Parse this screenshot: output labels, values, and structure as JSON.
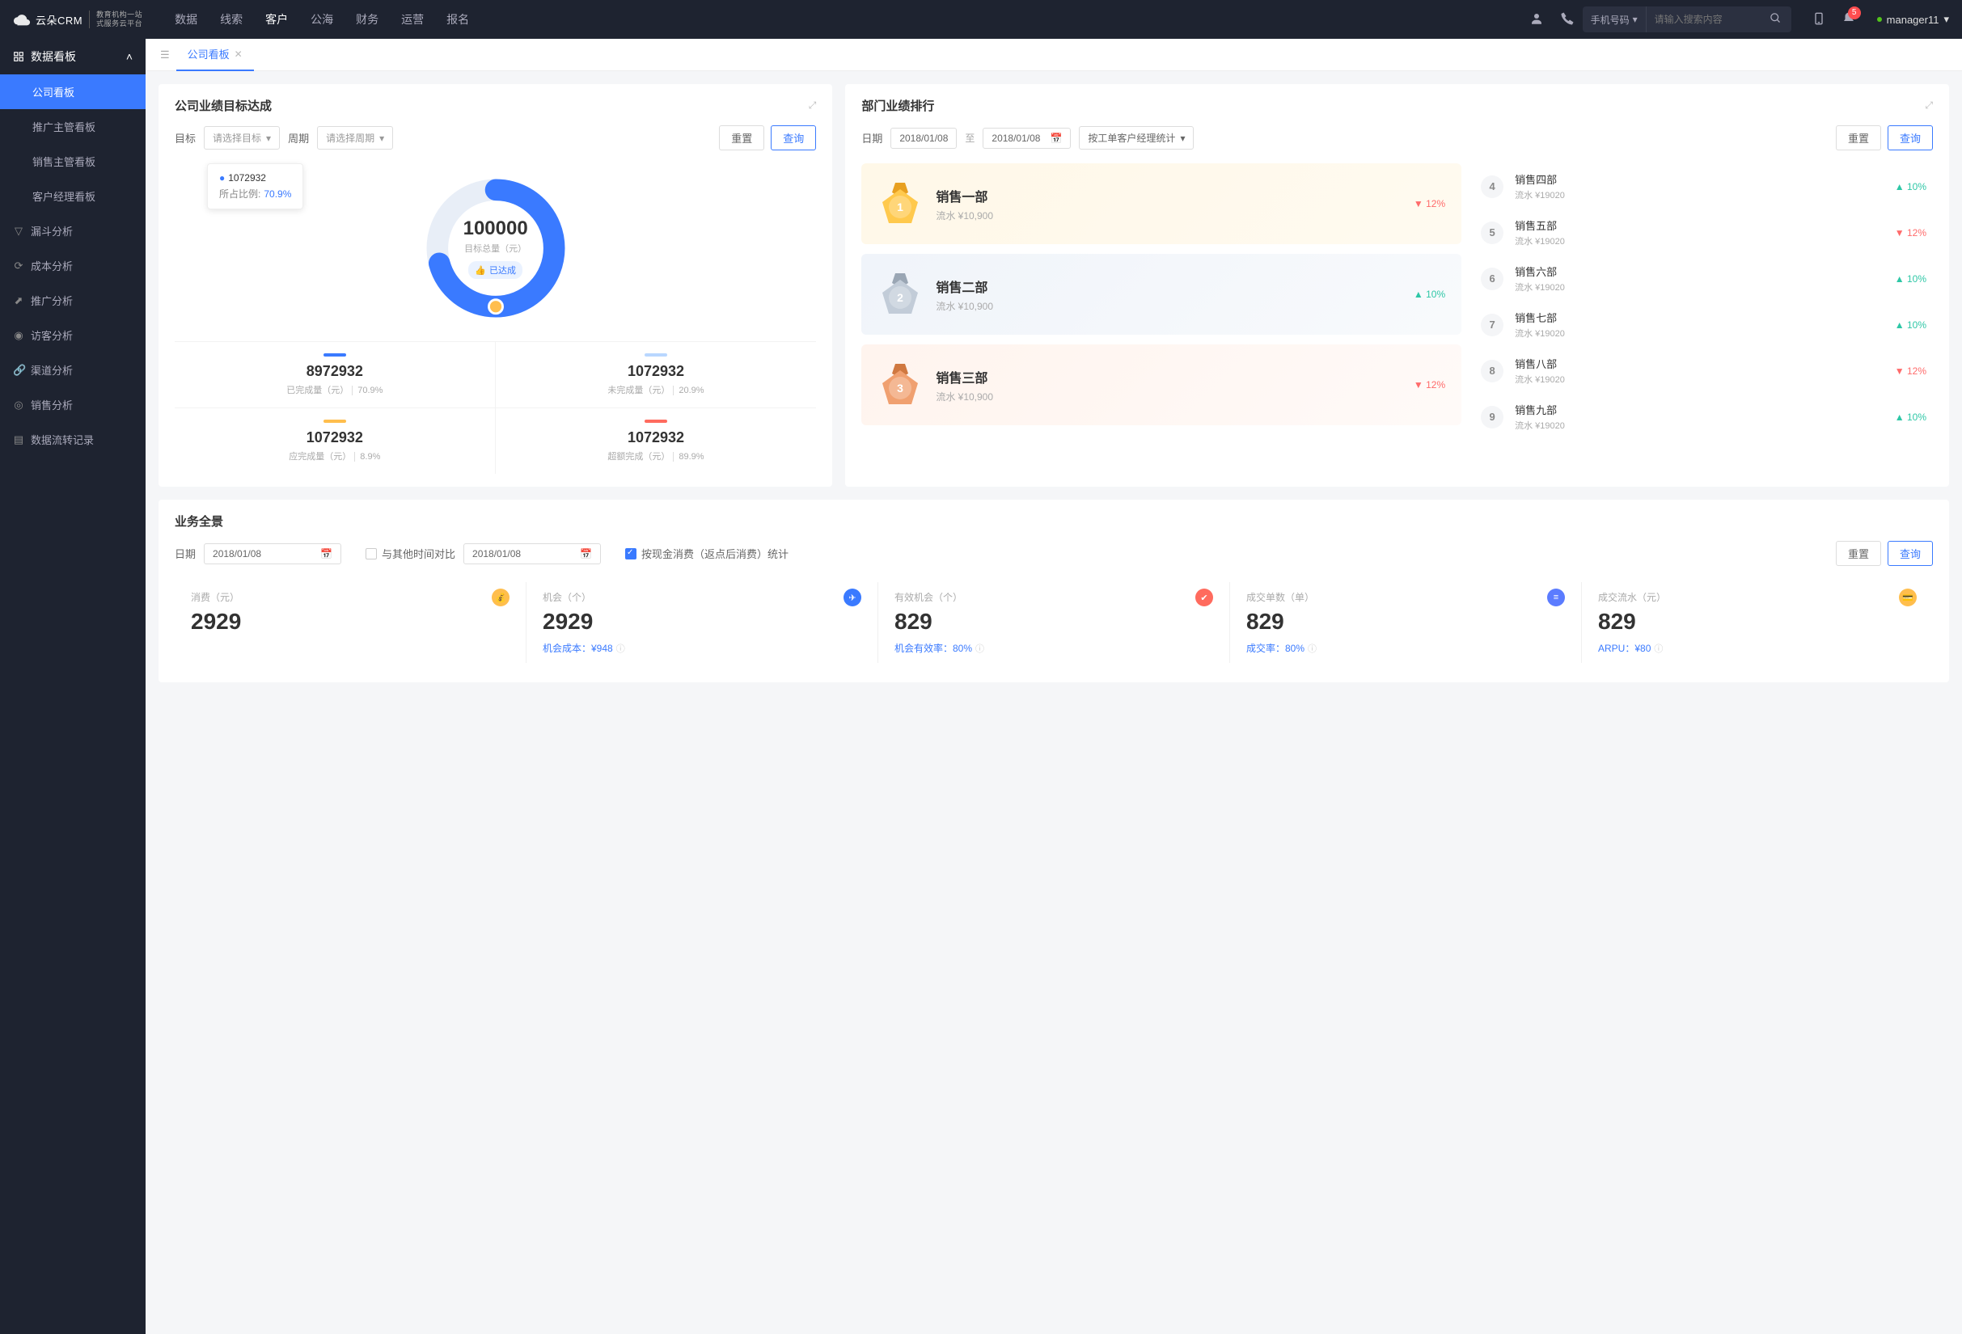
{
  "brand": {
    "name": "云朵CRM",
    "tagline1": "教育机构一站",
    "tagline2": "式服务云平台"
  },
  "topnav": {
    "items": [
      "数据",
      "线索",
      "客户",
      "公海",
      "财务",
      "运营",
      "报名"
    ],
    "active": 2
  },
  "search": {
    "type": "手机号码",
    "placeholder": "请输入搜索内容"
  },
  "notif_count": "5",
  "user": "manager11",
  "sidebar": {
    "header": "数据看板",
    "sub": [
      "公司看板",
      "推广主管看板",
      "销售主管看板",
      "客户经理看板"
    ],
    "items": [
      "漏斗分析",
      "成本分析",
      "推广分析",
      "访客分析",
      "渠道分析",
      "销售分析",
      "数据流转记录"
    ]
  },
  "tab": {
    "label": "公司看板"
  },
  "goal": {
    "title": "公司业绩目标达成",
    "labels": {
      "target": "目标",
      "period": "周期",
      "target_ph": "请选择目标",
      "period_ph": "请选择周期"
    },
    "btns": {
      "reset": "重置",
      "query": "查询"
    },
    "tooltip": {
      "value": "1072932",
      "ratio_label": "所占比例:",
      "ratio": "70.9%"
    },
    "center": {
      "value": "100000",
      "label": "目标总量（元）",
      "badge": "已达成"
    },
    "stats": [
      {
        "bar": "#3a7aff",
        "value": "8972932",
        "label": "已完成量（元）",
        "pct": "70.9%"
      },
      {
        "bar": "#b9d7ff",
        "value": "1072932",
        "label": "未完成量（元）",
        "pct": "20.9%"
      },
      {
        "bar": "#ffbe4d",
        "value": "1072932",
        "label": "应完成量（元）",
        "pct": "8.9%"
      },
      {
        "bar": "#ff6b5e",
        "value": "1072932",
        "label": "超额完成（元）",
        "pct": "89.9%"
      }
    ]
  },
  "rank": {
    "title": "部门业绩排行",
    "labels": {
      "date": "日期",
      "to": "至",
      "stat_by": "按工单客户经理统计"
    },
    "date_from": "2018/01/08",
    "date_to": "2018/01/08",
    "btns": {
      "reset": "重置",
      "query": "查询"
    },
    "top3": [
      {
        "rank": "1",
        "name": "销售一部",
        "sub_prefix": "流水 ",
        "sub_val": "¥10,900",
        "delta": "12%",
        "dir": "down"
      },
      {
        "rank": "2",
        "name": "销售二部",
        "sub_prefix": "流水 ",
        "sub_val": "¥10,900",
        "delta": "10%",
        "dir": "up"
      },
      {
        "rank": "3",
        "name": "销售三部",
        "sub_prefix": "流水 ",
        "sub_val": "¥10,900",
        "delta": "12%",
        "dir": "down"
      }
    ],
    "rest": [
      {
        "rank": "4",
        "name": "销售四部",
        "sub": "流水 ¥19020",
        "delta": "10%",
        "dir": "up"
      },
      {
        "rank": "5",
        "name": "销售五部",
        "sub": "流水 ¥19020",
        "delta": "12%",
        "dir": "down"
      },
      {
        "rank": "6",
        "name": "销售六部",
        "sub": "流水 ¥19020",
        "delta": "10%",
        "dir": "up"
      },
      {
        "rank": "7",
        "name": "销售七部",
        "sub": "流水 ¥19020",
        "delta": "10%",
        "dir": "up"
      },
      {
        "rank": "8",
        "name": "销售八部",
        "sub": "流水 ¥19020",
        "delta": "12%",
        "dir": "down"
      },
      {
        "rank": "9",
        "name": "销售九部",
        "sub": "流水 ¥19020",
        "delta": "10%",
        "dir": "up"
      }
    ]
  },
  "biz": {
    "title": "业务全景",
    "labels": {
      "date": "日期",
      "compare": "与其他时间对比",
      "cash_stat": "按现金消费（返点后消费）统计"
    },
    "date1": "2018/01/08",
    "date2": "2018/01/08",
    "btns": {
      "reset": "重置",
      "query": "查询"
    },
    "metrics": [
      {
        "label": "消费（元）",
        "value": "2929",
        "sub_label": "",
        "sub_value": "",
        "icon_bg": "#ffbe4d",
        "icon": "💰"
      },
      {
        "label": "机会（个）",
        "value": "2929",
        "sub_label": "机会成本：",
        "sub_value": "¥948",
        "icon_bg": "#3a7aff",
        "icon": "✈"
      },
      {
        "label": "有效机会（个）",
        "value": "829",
        "sub_label": "机会有效率：",
        "sub_value": "80%",
        "icon_bg": "#ff6b5e",
        "icon": "✔"
      },
      {
        "label": "成交单数（单）",
        "value": "829",
        "sub_label": "成交率：",
        "sub_value": "80%",
        "icon_bg": "#5b7cff",
        "icon": "≡"
      },
      {
        "label": "成交流水（元）",
        "value": "829",
        "sub_label": "ARPU：",
        "sub_value": "¥80",
        "icon_bg": "#ffbe4d",
        "icon": "💳"
      }
    ]
  },
  "chart_data": {
    "type": "pie",
    "title": "公司业绩目标达成",
    "total": 100000,
    "total_label": "目标总量（元）",
    "series": [
      {
        "name": "已完成量（元）",
        "value": 8972932,
        "pct": 70.9,
        "color": "#3a7aff"
      },
      {
        "name": "未完成量（元）",
        "value": 1072932,
        "pct": 20.9,
        "color": "#b9d7ff"
      },
      {
        "name": "应完成量（元）",
        "value": 1072932,
        "pct": 8.9,
        "color": "#ffbe4d"
      },
      {
        "name": "超额完成（元）",
        "value": 1072932,
        "pct": 89.9,
        "color": "#ff6b5e"
      }
    ],
    "highlight": {
      "value": 1072932,
      "ratio": 70.9
    }
  }
}
